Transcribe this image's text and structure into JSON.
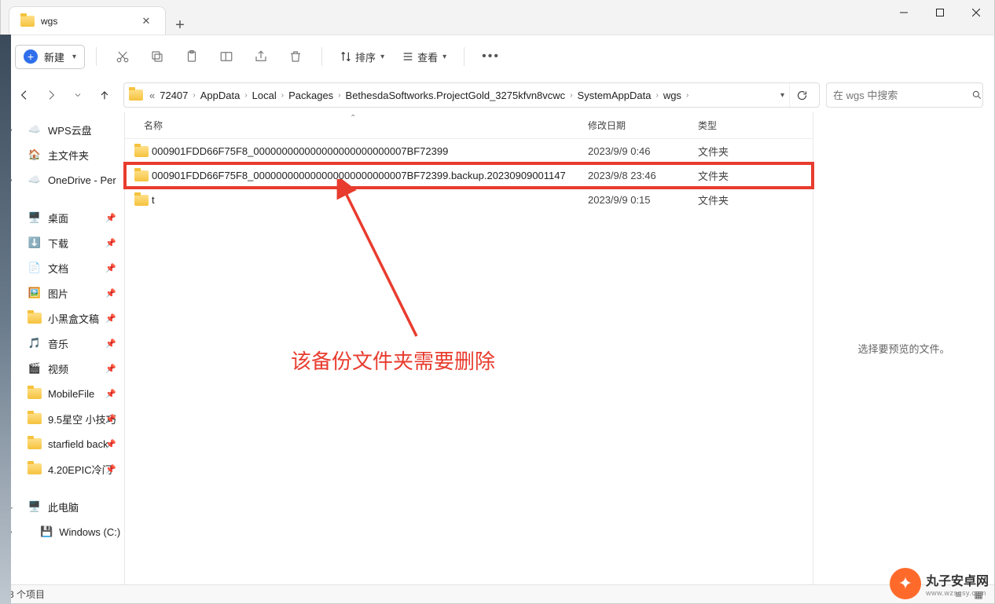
{
  "window": {
    "tab_title": "wgs"
  },
  "toolbar": {
    "new_label": "新建",
    "sort_label": "排序",
    "view_label": "查看"
  },
  "breadcrumb": {
    "overflow": "«",
    "items": [
      "72407",
      "AppData",
      "Local",
      "Packages",
      "BethesdaSoftworks.ProjectGold_3275kfvn8vcwc",
      "SystemAppData",
      "wgs"
    ]
  },
  "search": {
    "placeholder": "在 wgs 中搜索"
  },
  "sidebar": {
    "top": [
      {
        "label": "WPS云盘",
        "icon": "cloud-blue"
      },
      {
        "label": "主文件夹",
        "icon": "home"
      },
      {
        "label": "OneDrive - Personal",
        "icon": "cloud-blue2",
        "truncated": "OneDrive - Per"
      }
    ],
    "quick": [
      {
        "label": "桌面",
        "icon": "desktop",
        "color": "#2aa5d8"
      },
      {
        "label": "下载",
        "icon": "download",
        "color": "#2aa5d8"
      },
      {
        "label": "文档",
        "icon": "doc",
        "color": "#4a6fa0"
      },
      {
        "label": "图片",
        "icon": "pic",
        "color": "#2aa5d8"
      },
      {
        "label": "小黑盒文稿",
        "icon": "folder"
      },
      {
        "label": "音乐",
        "icon": "music",
        "color": "#e64a7a"
      },
      {
        "label": "视频",
        "icon": "video",
        "color": "#7a55c8"
      },
      {
        "label": "MobileFile",
        "icon": "folder"
      },
      {
        "label": "9.5星空 小技巧",
        "icon": "folder",
        "truncated": "9.5星空 小技巧"
      },
      {
        "label": "starfield backup",
        "icon": "folder",
        "truncated": "starfield back"
      },
      {
        "label": "4.20EPIC冷门",
        "icon": "folder"
      }
    ],
    "thispc": {
      "label": "此电脑",
      "drive": "Windows (C:)"
    }
  },
  "columns": {
    "name": "名称",
    "date": "修改日期",
    "type": "类型"
  },
  "files": [
    {
      "name": "000901FDD66F75F8_000000000000000000000000007BF72399",
      "date": "2023/9/9 0:46",
      "type": "文件夹"
    },
    {
      "name": "000901FDD66F75F8_000000000000000000000000007BF72399.backup.20230909001147",
      "date": "2023/9/8 23:46",
      "type": "文件夹",
      "highlight": true
    },
    {
      "name": "t",
      "date": "2023/9/9 0:15",
      "type": "文件夹"
    }
  ],
  "preview": {
    "placeholder": "选择要预览的文件。"
  },
  "status": {
    "count": "3 个项目"
  },
  "annotation": {
    "text": "该备份文件夹需要删除"
  },
  "watermark": {
    "line1": "丸子安卓网",
    "line2": "www.wzsqsy.com"
  }
}
